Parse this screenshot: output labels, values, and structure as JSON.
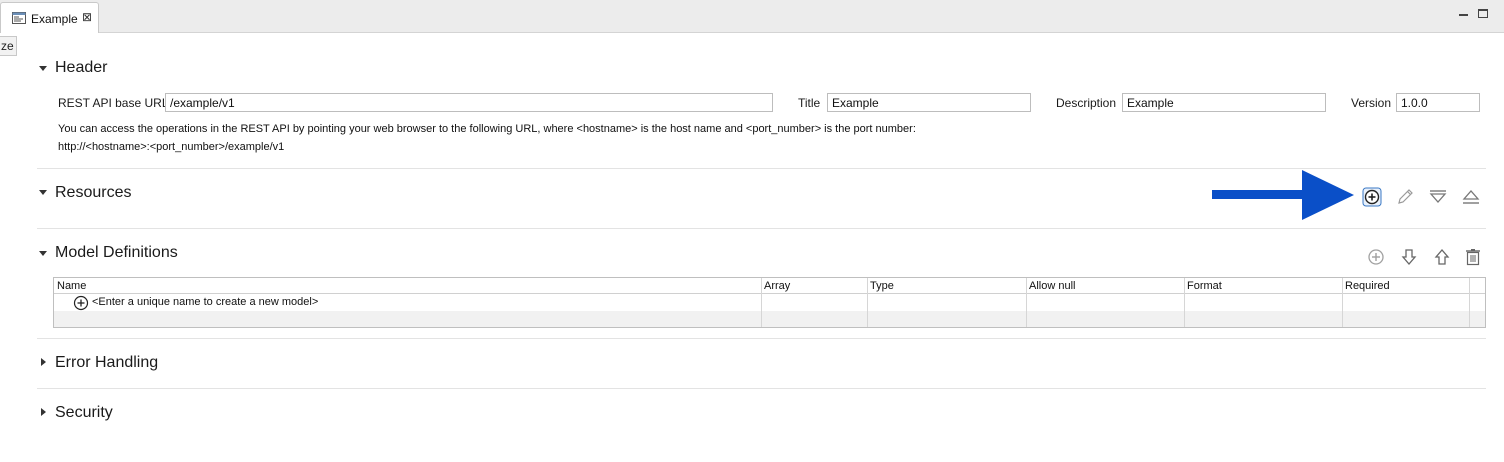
{
  "tab": {
    "label": "Example",
    "close_glyph": "⊠"
  },
  "tooltip_fragment": "ze",
  "sections": {
    "header": {
      "title": "Header"
    },
    "resources": {
      "title": "Resources"
    },
    "models": {
      "title": "Model Definitions"
    },
    "errors": {
      "title": "Error Handling"
    },
    "security": {
      "title": "Security"
    }
  },
  "header_fields": {
    "base_url_label": "REST API base URL",
    "base_url_value": "/example/v1",
    "title_label": "Title",
    "title_value": "Example",
    "description_label": "Description",
    "description_value": "Example",
    "version_label": "Version",
    "version_value": "1.0.0"
  },
  "info_text": {
    "line1": "You can access the operations in the REST API by pointing your web browser to the following URL, where <hostname> is the host name and <port_number> is the port number:",
    "line2": "http://<hostname>:<port_number>/example/v1"
  },
  "resources_toolbar": [
    "add-icon",
    "edit-icon",
    "expand-all-icon",
    "collapse-all-icon"
  ],
  "models_toolbar": [
    "add-icon",
    "move-down-icon",
    "move-up-icon",
    "delete-icon"
  ],
  "annotation": {
    "arrow_color": "#0a4fc8"
  },
  "models_table": {
    "columns": [
      "Name",
      "Array",
      "Type",
      "Allow null",
      "Format",
      "Required"
    ],
    "new_row_text": "<Enter a unique name to create a new model>"
  }
}
